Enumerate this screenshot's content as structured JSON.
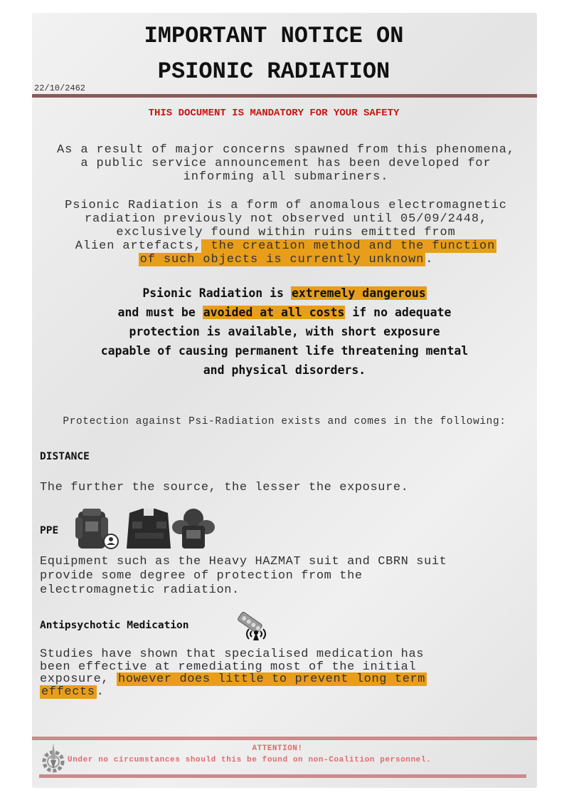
{
  "header": {
    "title_line1": "IMPORTANT NOTICE ON",
    "title_line2": "PSIONIC RADIATION",
    "date": "22/10/2462",
    "mandatory": "THIS DOCUMENT IS MANDATORY FOR YOUR SAFETY"
  },
  "intro": {
    "line1": "As a result of major concerns spawned from this phenomena,",
    "line2": "a public service announcement has been developed for",
    "line3": "informing all submariners."
  },
  "definition": {
    "line1": "Psionic Radiation is a form of anomalous electromagnetic",
    "line2": "radiation previously not observed until 05/09/2448,",
    "line3": "exclusively found within ruins emitted from",
    "line4_plain": "Alien artefacts,",
    "line4_hl": " the creation method and the function ",
    "line5_hl": "of such objects is currently unknown",
    "line5_end": "."
  },
  "warning": {
    "l1_a": "Psionic Radiation is ",
    "l1_hl": "extremely dangerous",
    "l2_a": "and must be ",
    "l2_hl": "avoided at all costs",
    "l2_b": " if no adequate",
    "l3": "protection is available, with short exposure",
    "l4": "capable of causing permanent life threatening mental",
    "l5": "and physical disorders."
  },
  "protection_intro": "Protection against Psi-Radiation exists and comes in the following:",
  "sections": {
    "distance_heading": "DISTANCE",
    "distance_text": "The further the source, the lesser the exposure.",
    "ppe_heading": "PPE",
    "ppe_line1": "Equipment such as the Heavy HAZMAT suit and CBRN suit",
    "ppe_line2": "provide some degree of protection from the",
    "ppe_line3": "electromagnetic radiation.",
    "med_heading": "Antipsychotic Medication",
    "med_line1": "Studies have shown that specialised medication has",
    "med_line2": "been effective at remediating most of the initial",
    "med_line3_a": "exposure, ",
    "med_line3_hl": "however does little to prevent long term",
    "med_line4_hl": "effects",
    "med_line4_end": "."
  },
  "footer": {
    "attention": "ATTENTION!",
    "note": "Under no circumstances should this be found on non-Coalition personnel."
  },
  "icons": {
    "suits": [
      "hazmat-suit-icon",
      "cbrn-suit-icon",
      "armored-suit-icon"
    ],
    "medication": "medication-pills-icon",
    "logo": "coalition-gear-logo"
  },
  "colors": {
    "highlight": "#e89e1a",
    "warning_red": "#cc1111",
    "footer_red": "#e06a6a"
  }
}
